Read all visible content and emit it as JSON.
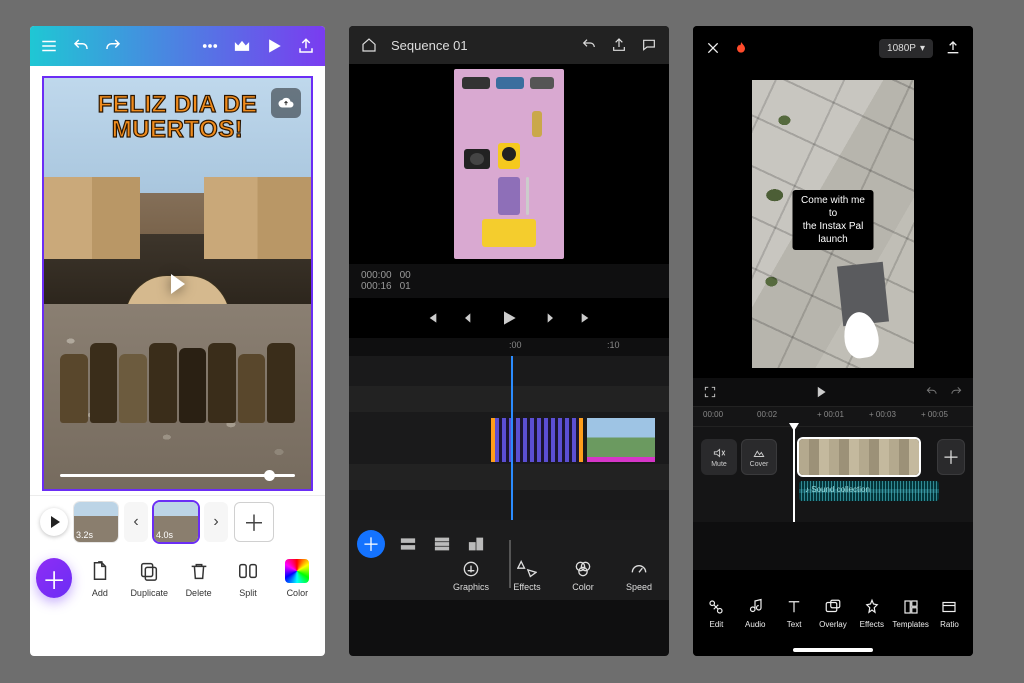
{
  "app1": {
    "overlay_text": "FELIZ DIA DE MUERTOS!",
    "clips": [
      {
        "duration_label": "3.2s"
      },
      {
        "duration_label": "4.0s"
      }
    ],
    "tools": {
      "add": "Add",
      "duplicate": "Duplicate",
      "delete": "Delete",
      "split": "Split",
      "color": "Color"
    }
  },
  "app2": {
    "sequence_title": "Sequence 01",
    "time_current": "000:00",
    "frame_current": "00",
    "time_total": "000:16",
    "frame_total": "01",
    "ruler": {
      "t0": ":00",
      "t10": ":10"
    },
    "tools": {
      "graphics": "Graphics",
      "effects": "Effects",
      "color": "Color",
      "speed": "Speed"
    }
  },
  "app3": {
    "resolution_label": "1080P",
    "caption_line1": "Come with me to",
    "caption_line2": "the Instax Pal launch",
    "cover_label": "Cover",
    "mute_label": "Mute",
    "audio_label": "Sound collection",
    "ruler": {
      "t0": "00:00",
      "t02": "00:02",
      "t01": "+ 00:01",
      "t03": "+ 00:03",
      "t05": "+ 00:05"
    },
    "tools": {
      "edit": "Edit",
      "audio": "Audio",
      "text": "Text",
      "overlay": "Overlay",
      "effects": "Effects",
      "templates": "Templates",
      "ratio": "Ratio"
    }
  }
}
